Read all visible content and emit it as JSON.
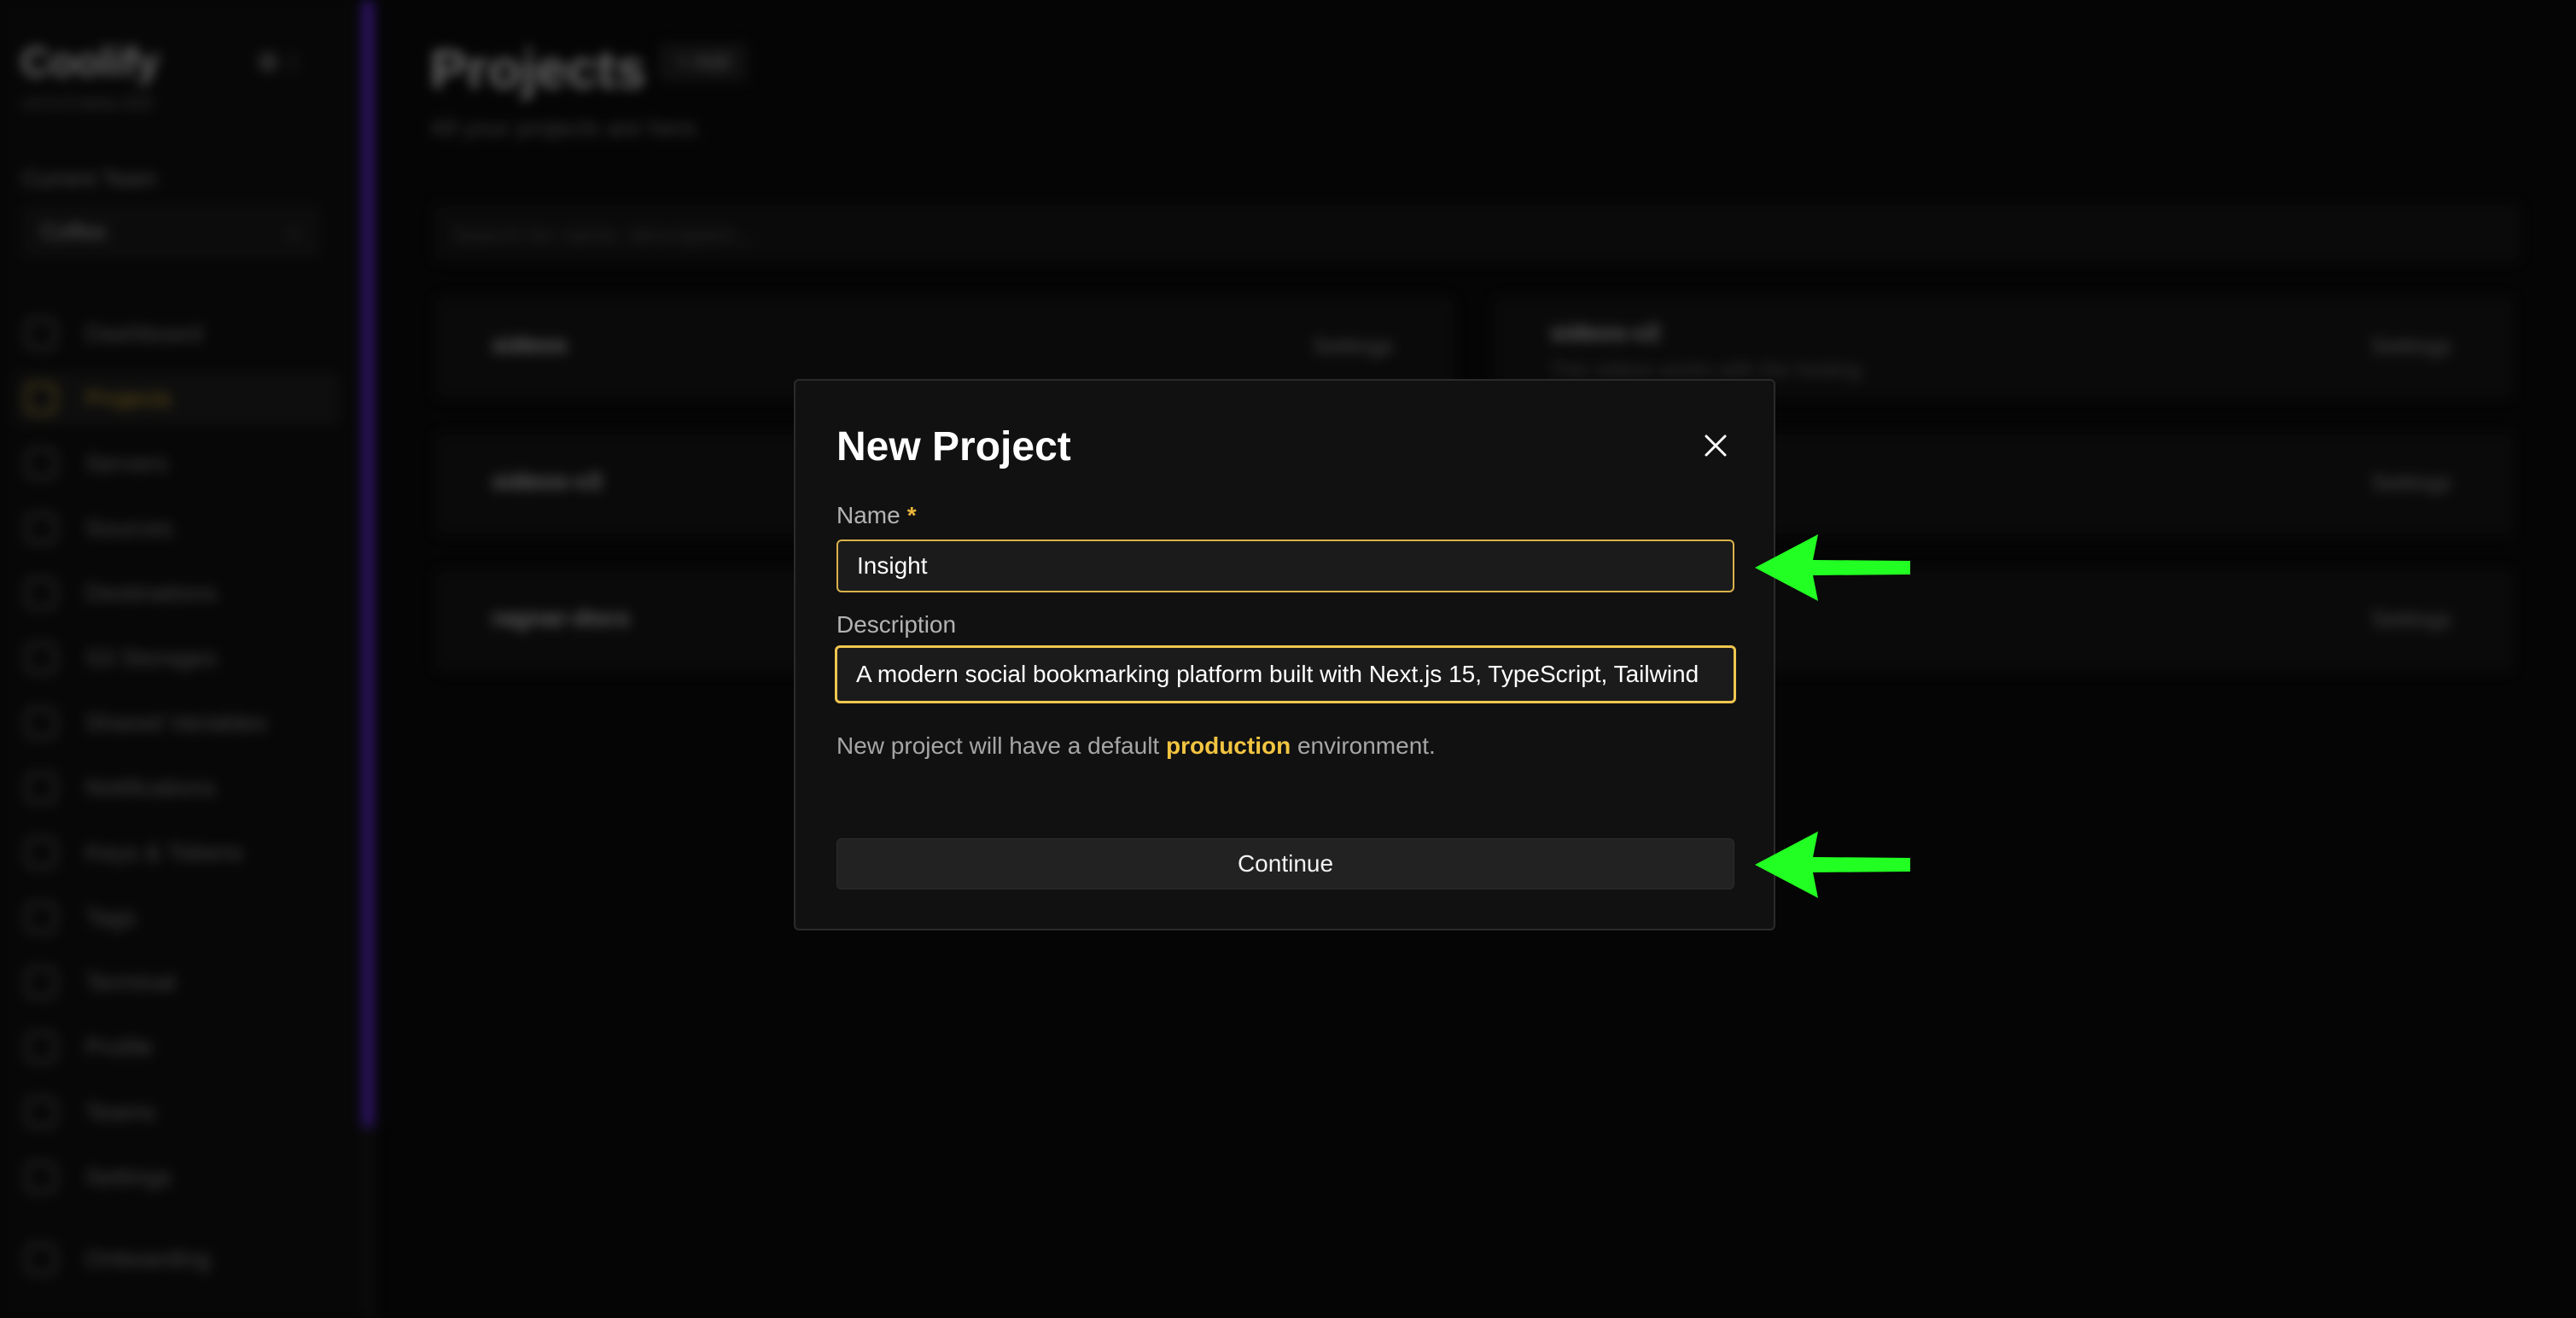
{
  "sidebar": {
    "app_name": "Coolify",
    "version": "v4.0.0-beta.420",
    "team_label": "Current Team",
    "team_value": "Coffee",
    "items": [
      {
        "label": "Dashboard",
        "icon": "home-icon"
      },
      {
        "label": "Projects",
        "icon": "layers-icon",
        "active": true
      },
      {
        "label": "Servers",
        "icon": "server-icon"
      },
      {
        "label": "Sources",
        "icon": "git-icon"
      },
      {
        "label": "Destinations",
        "icon": "destination-icon"
      },
      {
        "label": "S3 Storages",
        "icon": "storage-icon"
      },
      {
        "label": "Shared Variables",
        "icon": "variables-icon"
      },
      {
        "label": "Notifications",
        "icon": "bell-icon"
      },
      {
        "label": "Keys & Tokens",
        "icon": "key-icon"
      },
      {
        "label": "Tags",
        "icon": "tag-icon"
      },
      {
        "label": "Terminal",
        "icon": "terminal-icon"
      },
      {
        "label": "Profile",
        "icon": "user-icon"
      },
      {
        "label": "Teams",
        "icon": "users-icon"
      },
      {
        "label": "Settings",
        "icon": "gear-icon"
      },
      {
        "label": "Onboarding",
        "icon": "onboarding-icon"
      }
    ]
  },
  "main": {
    "title": "Projects",
    "add_label": "+ Add",
    "subtitle": "All your projects are here.",
    "search_placeholder": "Search for name, description...",
    "settings_label": "Settings",
    "projects": [
      {
        "name": "sideos",
        "description": ""
      },
      {
        "name": "sideos-v2",
        "description": "This sideos works with the hosting"
      },
      {
        "name": "sideos-v3",
        "description": ""
      },
      {
        "name": "",
        "description": ""
      },
      {
        "name": "ragnar-docs",
        "description": ""
      },
      {
        "name": "",
        "description": ""
      }
    ]
  },
  "modal": {
    "title": "New Project",
    "name_label": "Name",
    "required_mark": "*",
    "name_value": "Insight",
    "description_label": "Description",
    "description_value": "A modern social bookmarking platform built with Next.js 15, TypeScript, Tailwind",
    "hint_prefix": "New project will have a default ",
    "hint_highlight": "production",
    "hint_suffix": " environment.",
    "continue_label": "Continue"
  },
  "colors": {
    "accent": "#f2c441",
    "sidebar_edge": "#6b2cf5",
    "annotation_arrow": "#22ff22"
  }
}
